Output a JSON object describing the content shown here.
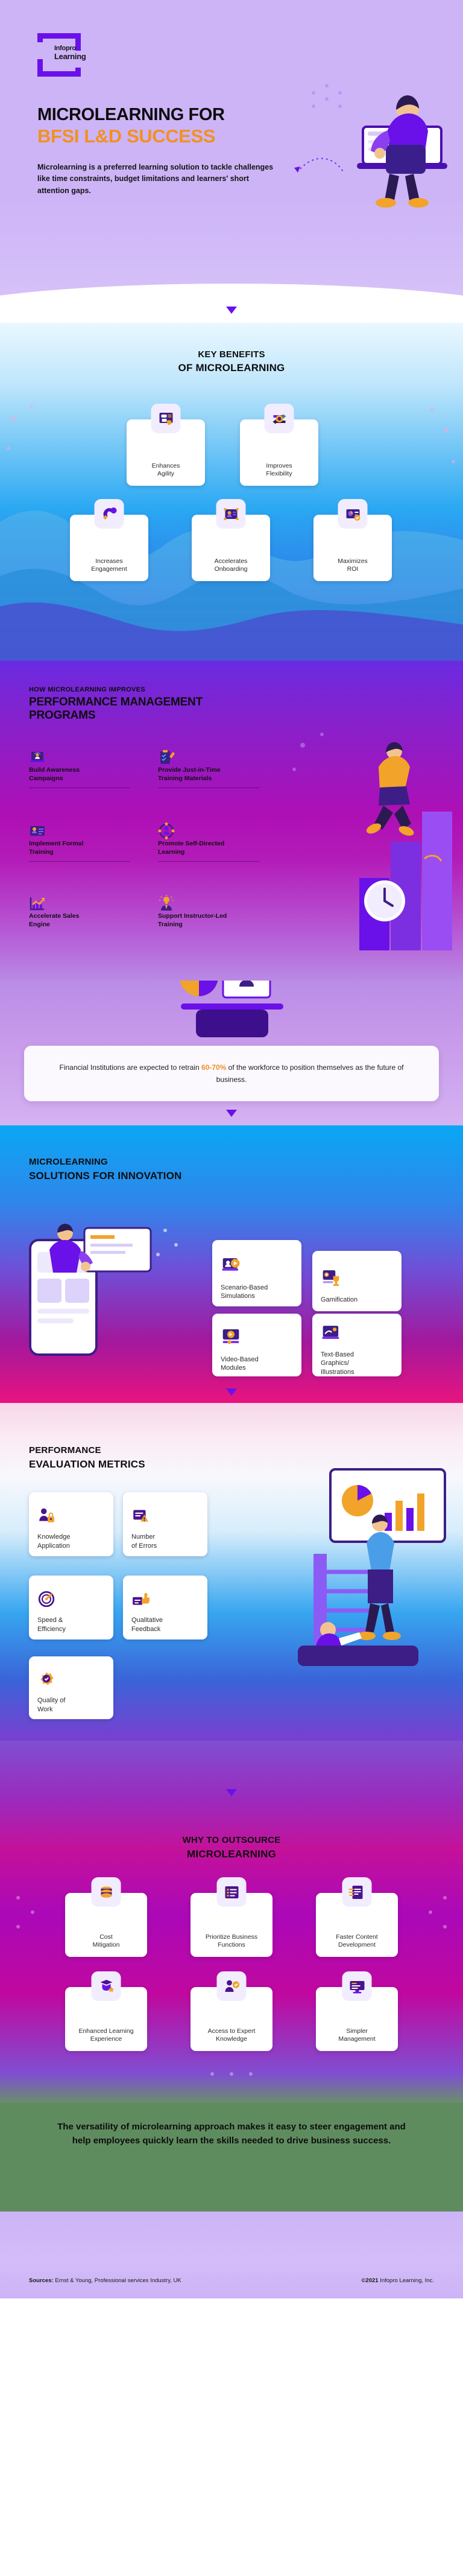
{
  "brand": {
    "logo_line1": "Infopro",
    "logo_line2": "Learning",
    "accent_orange": "#f09220",
    "accent_purple": "#6a10e8"
  },
  "hero": {
    "title_line1": "MICROLEARNING FOR",
    "title_line2": "BFSI L&D SUCCESS",
    "paragraph": "Microlearning is a preferred learning solution to tackle challenges like time constraints, budget limitations and learners' short attention gaps."
  },
  "benefits": {
    "title_line1": "KEY BENEFITS",
    "title_line2": "OF MICROLEARNING",
    "items": [
      {
        "label": "Enhances\nAgility",
        "icon": "tablet-tap-icon"
      },
      {
        "label": "Improves\nFlexibility",
        "icon": "exchange-arrows-icon"
      },
      {
        "label": "Increases\nEngagement",
        "icon": "magnet-icon"
      },
      {
        "label": "Accelerates\nOnboarding",
        "icon": "profile-card-icon"
      },
      {
        "label": "Maximizes\nROI",
        "icon": "chart-check-icon"
      }
    ]
  },
  "performance": {
    "eyebrow": "HOW MICROLEARNING IMPROVES",
    "title_line1": "PERFORMANCE MANAGEMENT",
    "title_line2": "PROGRAMS",
    "items": [
      {
        "label": "Build Awareness\nCampaigns",
        "icon": "laptop-broadcast-icon"
      },
      {
        "label": "Provide Just-in-Time\nTraining Materials",
        "icon": "clipboard-pencil-icon"
      },
      {
        "label": "Implement Formal\nTraining",
        "icon": "id-card-icon"
      },
      {
        "label": "Promote Self-Directed\nLearning",
        "icon": "network-user-icon"
      },
      {
        "label": "Accelerate Sales\nEngine",
        "icon": "growth-chart-icon"
      },
      {
        "label": "Support Instructor-Led\nTraining",
        "icon": "instructor-idea-icon"
      }
    ]
  },
  "stat": {
    "text_before": "Financial Institutions are expected to retrain ",
    "highlight": "60-70%",
    "text_after": " of the workforce to position themselves as the future of business."
  },
  "innovation": {
    "title_line1": "MICROLEARNING",
    "title_line2": "SOLUTIONS FOR INNOVATION",
    "items": [
      {
        "label": "Scenario-Based\nSimulations",
        "icon": "video-people-icon"
      },
      {
        "label": "Gamification",
        "icon": "trophy-screen-icon"
      },
      {
        "label": "Video-Based\nModules",
        "icon": "video-player-icon"
      },
      {
        "label": "Text-Based\nGraphics/\nIllustrations",
        "icon": "image-graphic-icon"
      }
    ]
  },
  "metrics": {
    "title_line1": "PERFORMANCE",
    "title_line2": "EVALUATION METRICS",
    "items": [
      {
        "label": "Knowledge\nApplication",
        "icon": "person-lock-icon"
      },
      {
        "label": "Number\nof Errors",
        "icon": "error-document-icon"
      },
      {
        "label": "Speed &\nEfficiency",
        "icon": "speed-gauge-icon"
      },
      {
        "label": "Qualitative\nFeedback",
        "icon": "thumbs-up-icon"
      },
      {
        "label": "Quality of\nWork",
        "icon": "quality-gear-icon"
      }
    ]
  },
  "outsource": {
    "title_line1": "WHY TO OUTSOURCE",
    "title_line2": "MICROLEARNING",
    "items": [
      {
        "label": "Cost\nMitigation",
        "icon": "coin-stack-icon"
      },
      {
        "label": "Prioritize Business\nFunctions",
        "icon": "priority-list-icon"
      },
      {
        "label": "Faster Content\nDevelopment",
        "icon": "fast-content-icon"
      },
      {
        "label": "Enhanced Learning\nExperience",
        "icon": "learning-star-icon"
      },
      {
        "label": "Access to Expert\nKnowledge",
        "icon": "expert-person-icon"
      },
      {
        "label": "Simpler\nManagement",
        "icon": "monitor-manage-icon"
      }
    ]
  },
  "conclusion": {
    "text": "The versatility of microlearning approach makes it easy to steer engagement and help employees quickly learn the skills needed to drive business success."
  },
  "footer": {
    "sources_label": "Sources:",
    "sources_value": "Ernst & Young, Professional services Industry, UK",
    "copyright_mark": "©2021",
    "copyright_text": "Infopro Learning, Inc."
  }
}
